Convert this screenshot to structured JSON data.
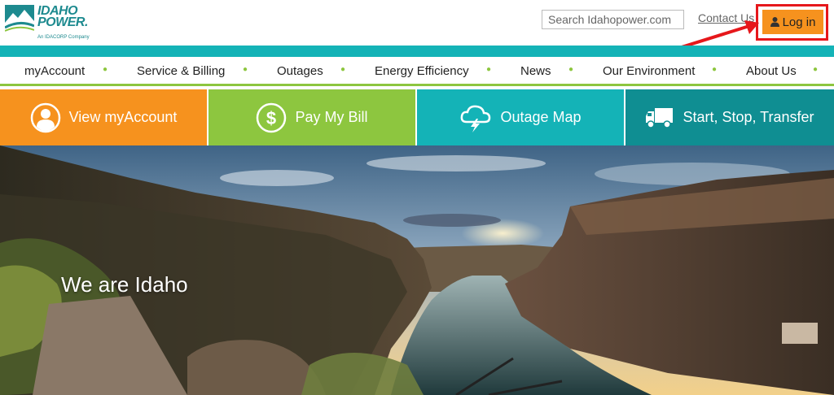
{
  "brand": {
    "name_line1": "IDAHO",
    "name_line2": "POWER.",
    "tagline": "An IDACORP Company",
    "colors": {
      "teal": "#14b3b7",
      "green": "#8dc63f",
      "orange": "#f6921e",
      "dark_teal": "#0f8e92"
    }
  },
  "header": {
    "search_placeholder": "Search Idahopower.com",
    "contact_label": "Contact Us",
    "login_label": "Log in",
    "login_icon": "user-icon"
  },
  "nav": {
    "items": [
      {
        "label": "myAccount"
      },
      {
        "label": "Service & Billing"
      },
      {
        "label": "Outages"
      },
      {
        "label": "Energy Efficiency"
      },
      {
        "label": "News"
      },
      {
        "label": "Our Environment"
      },
      {
        "label": "About Us"
      }
    ],
    "dropdown_icon": "bullet-dropdown-icon"
  },
  "tiles": [
    {
      "label": "View myAccount",
      "icon": "user-circle-icon",
      "color": "#f6921e"
    },
    {
      "label": "Pay My Bill",
      "icon": "dollar-circle-icon",
      "color": "#8dc63f"
    },
    {
      "label": "Outage Map",
      "icon": "storm-cloud-icon",
      "color": "#14b3b7"
    },
    {
      "label": "Start, Stop, Transfer",
      "icon": "truck-icon",
      "color": "#0f8e92"
    }
  ],
  "hero": {
    "title": "We are Idaho"
  }
}
